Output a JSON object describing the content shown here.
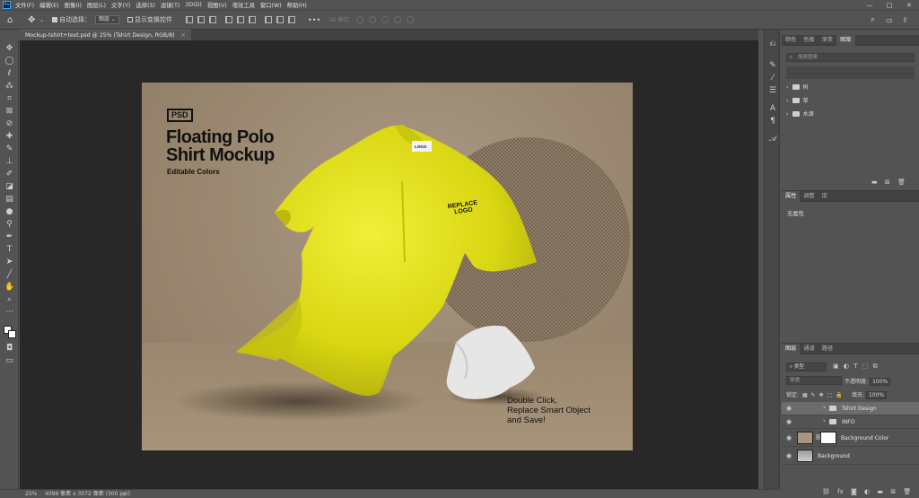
{
  "app": {
    "logo": "Ps"
  },
  "menu": [
    "文件(F)",
    "编辑(E)",
    "图像(I)",
    "图层(L)",
    "文字(Y)",
    "选择(S)",
    "滤镜(T)",
    "3D(D)",
    "视图(V)",
    "增效工具",
    "窗口(W)",
    "帮助(H)"
  ],
  "window_controls": {
    "minimize": "—",
    "maximize": "□",
    "close": "✕"
  },
  "options": {
    "auto_select_label": "自动选择：",
    "auto_select_value": "图层",
    "show_transform_label": "显示变换控件",
    "mode_3d_label": "3D 模式：",
    "more": "•••"
  },
  "document": {
    "tab_title": "Mockup-tshirt+text.psd @ 25% (Tshirt Design, RGB/8)",
    "close": "×"
  },
  "artwork": {
    "badge": "PSD",
    "title_line1": "Floating Polo",
    "title_line2": "Shirt Mockup",
    "subtitle": "Editable Colors",
    "logo_tag": "LOGO",
    "chest_logo": "REPLACE LOGO",
    "cta_line1": "Double Click,",
    "cta_line2": "Replace Smart Object",
    "cta_line3": "and Save!",
    "colors": {
      "shirt": "#e9e61f",
      "small_shirt": "#e4e4e4",
      "background": "#a6957f"
    }
  },
  "status": {
    "zoom": "25%",
    "doc_info": "4096 像素 x 3072 像素 (300 ppi)",
    "arrow": "›"
  },
  "colors_panel": {
    "tabs": [
      "颜色",
      "色板",
      "渐变",
      "图案"
    ],
    "active_tab": 3,
    "search_placeholder": "搜索图案",
    "groups": [
      "树",
      "草",
      "水滴"
    ]
  },
  "properties_panel": {
    "tabs": [
      "属性",
      "调整",
      "库"
    ],
    "active_tab": 0,
    "empty_label": "无属性"
  },
  "layers_panel": {
    "tabs": [
      "图层",
      "通道",
      "路径"
    ],
    "active_tab": 0,
    "filter_value": "类型",
    "blend_mode": "穿透",
    "opacity_label": "不透明度:",
    "opacity_value": "100%",
    "lock_label": "锁定:",
    "fill_label": "填充:",
    "fill_value": "100%",
    "layers": [
      {
        "name": "Tshirt Design",
        "type": "group",
        "selected": true
      },
      {
        "name": "INFO",
        "type": "group",
        "selected": false
      },
      {
        "name": "Background Color",
        "type": "fill",
        "selected": false
      },
      {
        "name": "Background",
        "type": "image",
        "selected": false
      }
    ]
  }
}
